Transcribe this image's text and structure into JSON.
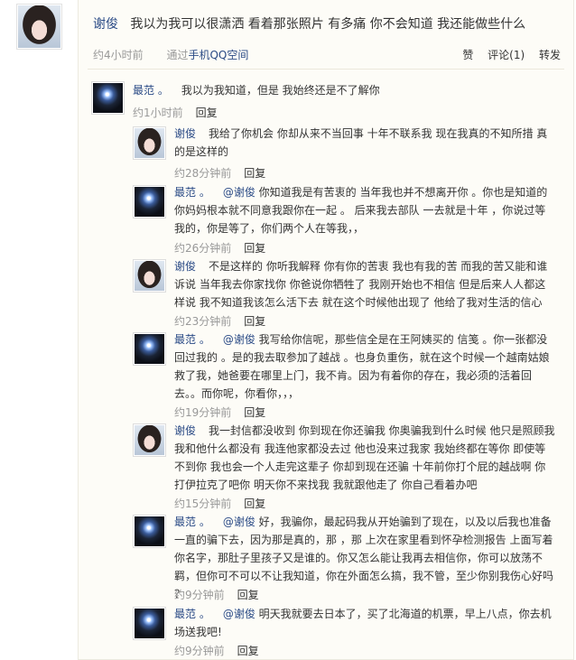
{
  "post": {
    "author": "谢俊",
    "text": "我以为我可以很潇洒 看着那张照片 有多痛 你不会知道 我还能做些什么",
    "time": "约4小时前",
    "via_prefix": "通过",
    "client": "手机QQ空间",
    "like_label": "赞",
    "comment_label": "评论(1)",
    "forward_label": "转发"
  },
  "comments": [
    {
      "author": "最范 。",
      "mention": "",
      "text": "我以为我知道，但是 我始终还是不了解你",
      "time": "约1小时前",
      "reply_label": "回复"
    },
    {
      "author": "谢俊",
      "mention": "",
      "text": "我给了你机会 你却从来不当回事 十年不联系我 现在我真的不知所措 真的是这样的",
      "time": "约28分钟前",
      "reply_label": "回复"
    },
    {
      "author": "最范 。",
      "mention": "@谢俊",
      "text": "你知道我是有苦衷的 当年我也并不想离开你 。你也是知道的 你妈妈根本就不同意我跟你在一起 。 后来我去部队 一去就是十年 ，你说过等我的，你是等了，你们两个人在等我，，",
      "time": "约26分钟前",
      "reply_label": "回复"
    },
    {
      "author": "谢俊",
      "mention": "",
      "text": "不是这样的 你听我解释 你有你的苦衷 我也有我的苦 而我的苦又能和谁诉说 当年我去你家找你 你爸说你牺牲了 我刚开始也不相信 但是后来人人都这样说 我不知道我该怎么活下去 就在这个时候他出现了 他给了我对生活的信心",
      "time": "约23分钟前",
      "reply_label": "回复"
    },
    {
      "author": "最范 。",
      "mention": "@谢俊",
      "text": "我写给你信呢，那些信全是在王阿姨买的 信笺 。你一张都没回过我的 。是的我去取参加了越战 。也身负重伤，就在这个时候一个越南姑娘救了我，她爸要在哪里上门，我不肯。因为有着你的存在，我必须的活着回去。。而你呢，你看你，，，",
      "time": "约19分钟前",
      "reply_label": "回复"
    },
    {
      "author": "谢俊",
      "mention": "",
      "text": "我一封信都没收到 你到现在你还骗我 你奥骗我到什么时候 他只是照顾我 我和他什么都没有 我连他家都没去过 他也没来过我家 我始终都在等你 即使等不到你 我也会一个人走完这辈子 你却到现在还骗 十年前你打个屁的越战啊 你打伊拉克了吧你 明天你不来找我 我就跟他走了 你自己看着办吧",
      "time": "约15分钟前",
      "reply_label": "回复"
    },
    {
      "author": "最范 。",
      "mention": "@谢俊",
      "text": "好，我骗你，最起码我从开始骗到了现在，以及以后我也准备一直的骗下去，因为那是真的，那 ，那 上次在家里看到怀孕检测报告 上面写着你名字，那肚子里孩子又是谁的。你又怎么能让我再去相信你，你可以放荡不羁，但你可不可以不让我知道，你在外面怎么搞，我不管，至少你别我伤心好吗 ？",
      "time": "约9分钟前",
      "reply_label": "回复"
    },
    {
      "author": "最范 。",
      "mention": "@谢俊",
      "text": "明天我就要去日本了，买了北海道的机票，早上八点，你去机场送我吧!",
      "time": "约9分钟前",
      "reply_label": "回复"
    }
  ]
}
